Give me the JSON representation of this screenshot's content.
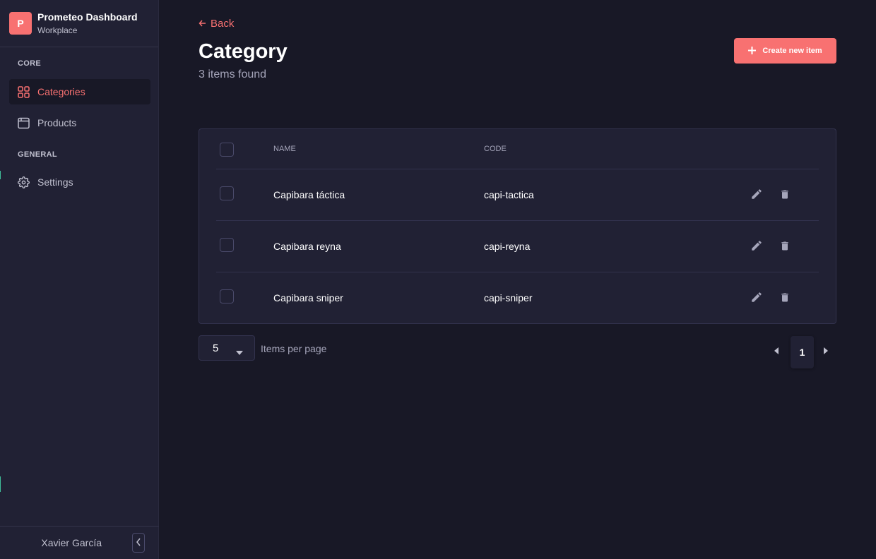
{
  "brand": {
    "logo_letter": "P",
    "title": "Prometeo Dashboard",
    "subtitle": "Workplace"
  },
  "sidebar": {
    "sections": [
      {
        "label": "CORE"
      },
      {
        "label": "GENERAL"
      }
    ],
    "items": [
      {
        "label": "Categories",
        "icon": "grid-icon",
        "active": true
      },
      {
        "label": "Products",
        "icon": "browser-window-icon",
        "active": false
      },
      {
        "label": "Settings",
        "icon": "gear-icon",
        "active": false
      }
    ],
    "user_name": "Xavier García"
  },
  "header": {
    "back_label": "Back",
    "title": "Category",
    "items_found": "3 items found",
    "create_label": "Create new item"
  },
  "table": {
    "columns": [
      "NAME",
      "CODE"
    ],
    "rows": [
      {
        "name": "Capibara táctica",
        "code": "capi-tactica"
      },
      {
        "name": "Capibara reyna",
        "code": "capi-reyna"
      },
      {
        "name": "Capibara sniper",
        "code": "capi-sniper"
      }
    ]
  },
  "pagination": {
    "per_page_value": "5",
    "per_page_label": "Items per page",
    "current_page": "1"
  },
  "colors": {
    "accent": "#f87171",
    "background": "#181826",
    "surface": "#212134",
    "muted_text": "#a5a5ba"
  }
}
